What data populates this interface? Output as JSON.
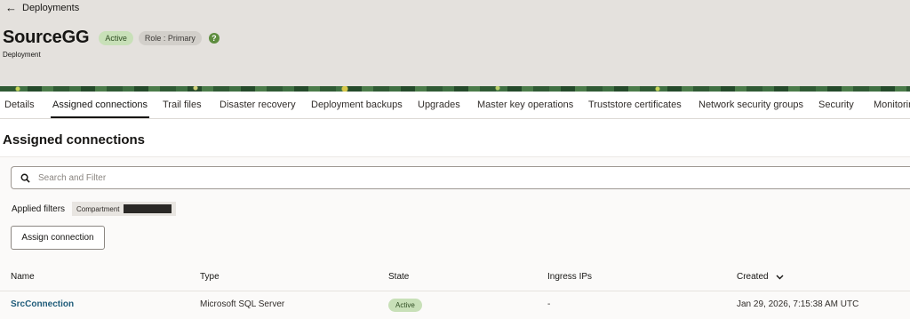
{
  "breadcrumb": {
    "back_label": "Deployments"
  },
  "header": {
    "title": "SourceGG",
    "status_badge": "Active",
    "role_badge": "Role : Primary",
    "subtitle": "Deployment"
  },
  "tabs": [
    {
      "label": "Details"
    },
    {
      "label": "Assigned connections",
      "active": true
    },
    {
      "label": "Trail files"
    },
    {
      "label": "Disaster recovery"
    },
    {
      "label": "Deployment backups"
    },
    {
      "label": "Upgrades"
    },
    {
      "label": "Master key operations"
    },
    {
      "label": "Truststore certificates"
    },
    {
      "label": "Network security groups"
    },
    {
      "label": "Security"
    },
    {
      "label": "Monitoring"
    }
  ],
  "section": {
    "title": "Assigned connections"
  },
  "search": {
    "placeholder": "Search and Filter",
    "value": ""
  },
  "filters": {
    "label": "Applied filters",
    "chip_label": "Compartment"
  },
  "actions": {
    "assign_label": "Assign connection"
  },
  "table": {
    "columns": [
      "Name",
      "Type",
      "State",
      "Ingress IPs",
      "Created"
    ],
    "sorted_column": "Created",
    "rows": [
      {
        "name": "SrcConnection",
        "type": "Microsoft SQL Server",
        "state": "Active",
        "ingress_ips": "-",
        "created": "Jan 29, 2026, 7:15:38 AM UTC"
      }
    ]
  },
  "colors": {
    "active_badge_bg": "#c8e0b8",
    "link": "#1f5c7a",
    "help_icon": "#5e8d3f"
  },
  "icons": [
    "arrow-left-icon",
    "help-icon",
    "search-icon",
    "chevron-down-icon"
  ]
}
